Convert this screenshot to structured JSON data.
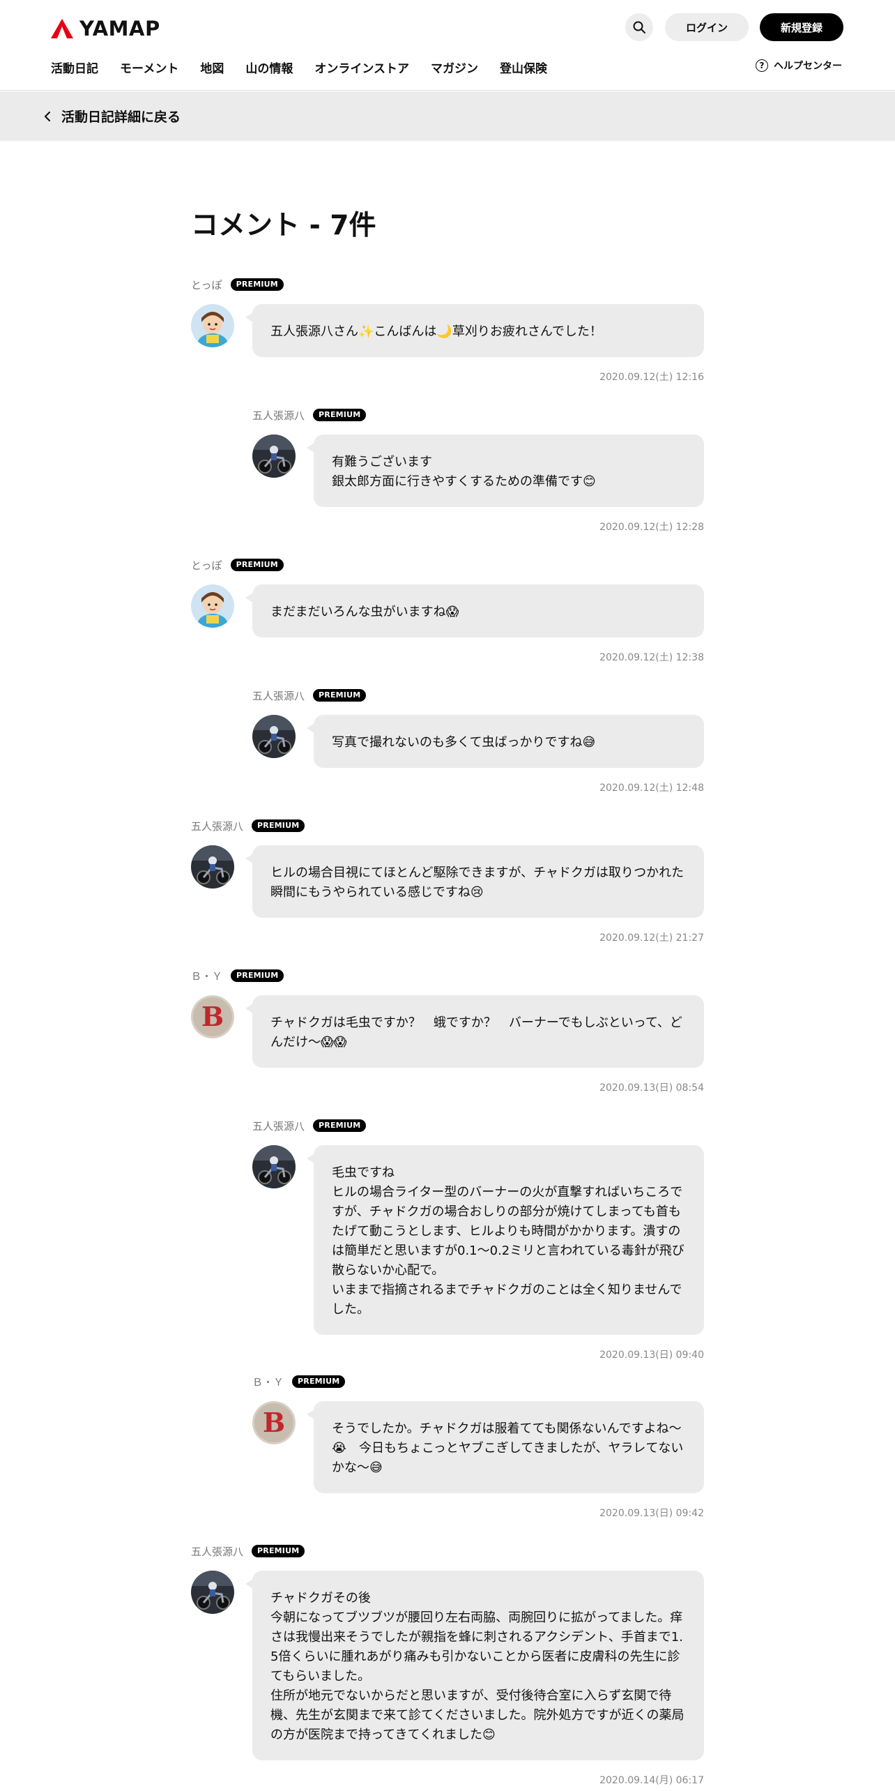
{
  "header": {
    "logo_text": "YAMAP",
    "login_label": "ログイン",
    "signup_label": "新規登録",
    "help_label": "ヘルプセンター",
    "nav": [
      "活動日記",
      "モーメント",
      "地図",
      "山の情報",
      "オンラインストア",
      "マガジン",
      "登山保険"
    ]
  },
  "back_label": "活動日記詳細に戻る",
  "page_title": "コメント - 7件",
  "premium_label": "PREMIUM",
  "colors": {
    "accent": "#e60012",
    "bubble": "#ebebeb",
    "badge": "#000000"
  },
  "comments": [
    {
      "name": "とっぽ",
      "avatar": "cartoon-hiker-avatar",
      "text": "五人張源八さん✨こんばんは🌙草刈りお疲れさんでした！",
      "date": "2020.09.12(土) 12:16",
      "reply": false
    },
    {
      "name": "五人張源八",
      "avatar": "motorcycle-rider-avatar",
      "text": "有難うございます\n銀太郎方面に行きやすくするための準備です😊",
      "date": "2020.09.12(土) 12:28",
      "reply": true
    },
    {
      "name": "とっぽ",
      "avatar": "cartoon-hiker-avatar",
      "text": "まだまだいろんな虫がいますね😱",
      "date": "2020.09.12(土) 12:38",
      "reply": false
    },
    {
      "name": "五人張源八",
      "avatar": "motorcycle-rider-avatar",
      "text": "写真で撮れないのも多くて虫ばっかりですね😅",
      "date": "2020.09.12(土) 12:48",
      "reply": true
    },
    {
      "name": "五人張源八",
      "avatar": "motorcycle-rider-avatar",
      "text": "ヒルの場合目視にてほとんど駆除できますが、チャドクガは取りつかれた瞬間にもうやられている感じですね😢",
      "date": "2020.09.12(土) 21:27",
      "reply": false
    },
    {
      "name": "Ｂ・Ｙ",
      "avatar": "letter-b-avatar",
      "text": "チャドクガは毛虫ですか？　蛾ですか？　バーナーでもしぶといって、どんだけ〜😱😱",
      "date": "2020.09.13(日) 08:54",
      "reply": false
    },
    {
      "name": "五人張源八",
      "avatar": "motorcycle-rider-avatar",
      "text": "毛虫ですね\nヒルの場合ライター型のバーナーの火が直撃すればいちころですが、チャドクガの場合おしりの部分が焼けてしまっても首もたげて動こうとします、ヒルよりも時間がかかります。潰すのは簡単だと思いますが0.1～0.2ミリと言われている毒針が飛び散らないか心配で。\nいままで指摘されるまでチャドクガのことは全く知りませんでした。",
      "date": "2020.09.13(日) 09:40",
      "reply": true
    },
    {
      "name": "Ｂ・Ｙ",
      "avatar": "letter-b-avatar",
      "text": "そうでしたか。チャドクガは服着てても関係ないんですよね〜😭　今日もちょこっとヤブこぎしてきましたが、ヤラレてないかな〜😅",
      "date": "2020.09.13(日) 09:42",
      "reply": true
    },
    {
      "name": "五人張源八",
      "avatar": "motorcycle-rider-avatar",
      "text": "チャドクガその後\n今朝になってブツブツが腰回り左右両脇、両腕回りに拡がってました。痒さは我慢出来そうでしたが親指を蜂に刺されるアクシデント、手首まで1.5倍くらいに腫れあがり痛みも引かないことから医者に皮膚科の先生に診てもらいました。\n住所が地元でないからだと思いますが、受付後待合室に入らず玄関で待機、先生が玄関まで来て診てくださいました。院外処方ですが近くの薬局の方が医院まで持ってきてくれました😊",
      "date": "2020.09.14(月) 06:17",
      "reply": false
    }
  ]
}
